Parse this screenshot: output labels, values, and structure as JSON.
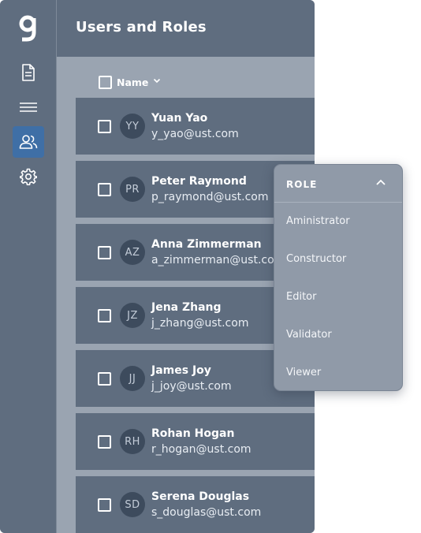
{
  "header": {
    "title": "Users and Roles"
  },
  "table": {
    "name_column_label": "Name"
  },
  "users": [
    {
      "initials": "YY",
      "name": "Yuan Yao",
      "email": "y_yao@ust.com"
    },
    {
      "initials": "PR",
      "name": "Peter Raymond",
      "email": "p_raymond@ust.com"
    },
    {
      "initials": "AZ",
      "name": "Anna Zimmerman",
      "email": "a_zimmerman@ust.com"
    },
    {
      "initials": "JZ",
      "name": "Jena Zhang",
      "email": "j_zhang@ust.com"
    },
    {
      "initials": "JJ",
      "name": "James Joy",
      "email": "j_joy@ust.com"
    },
    {
      "initials": "RH",
      "name": "Rohan Hogan",
      "email": "r_hogan@ust.com"
    },
    {
      "initials": "SD",
      "name": "Serena Douglas",
      "email": "s_douglas@ust.com"
    }
  ],
  "role_dropdown": {
    "title": "ROLE",
    "options": [
      "Aministrator",
      "Constructor",
      "Editor",
      "Validator",
      "Viewer"
    ]
  },
  "colors": {
    "panel": "#5f6d7f",
    "accent": "#3f6fa6",
    "background": "#9aa4b1"
  }
}
